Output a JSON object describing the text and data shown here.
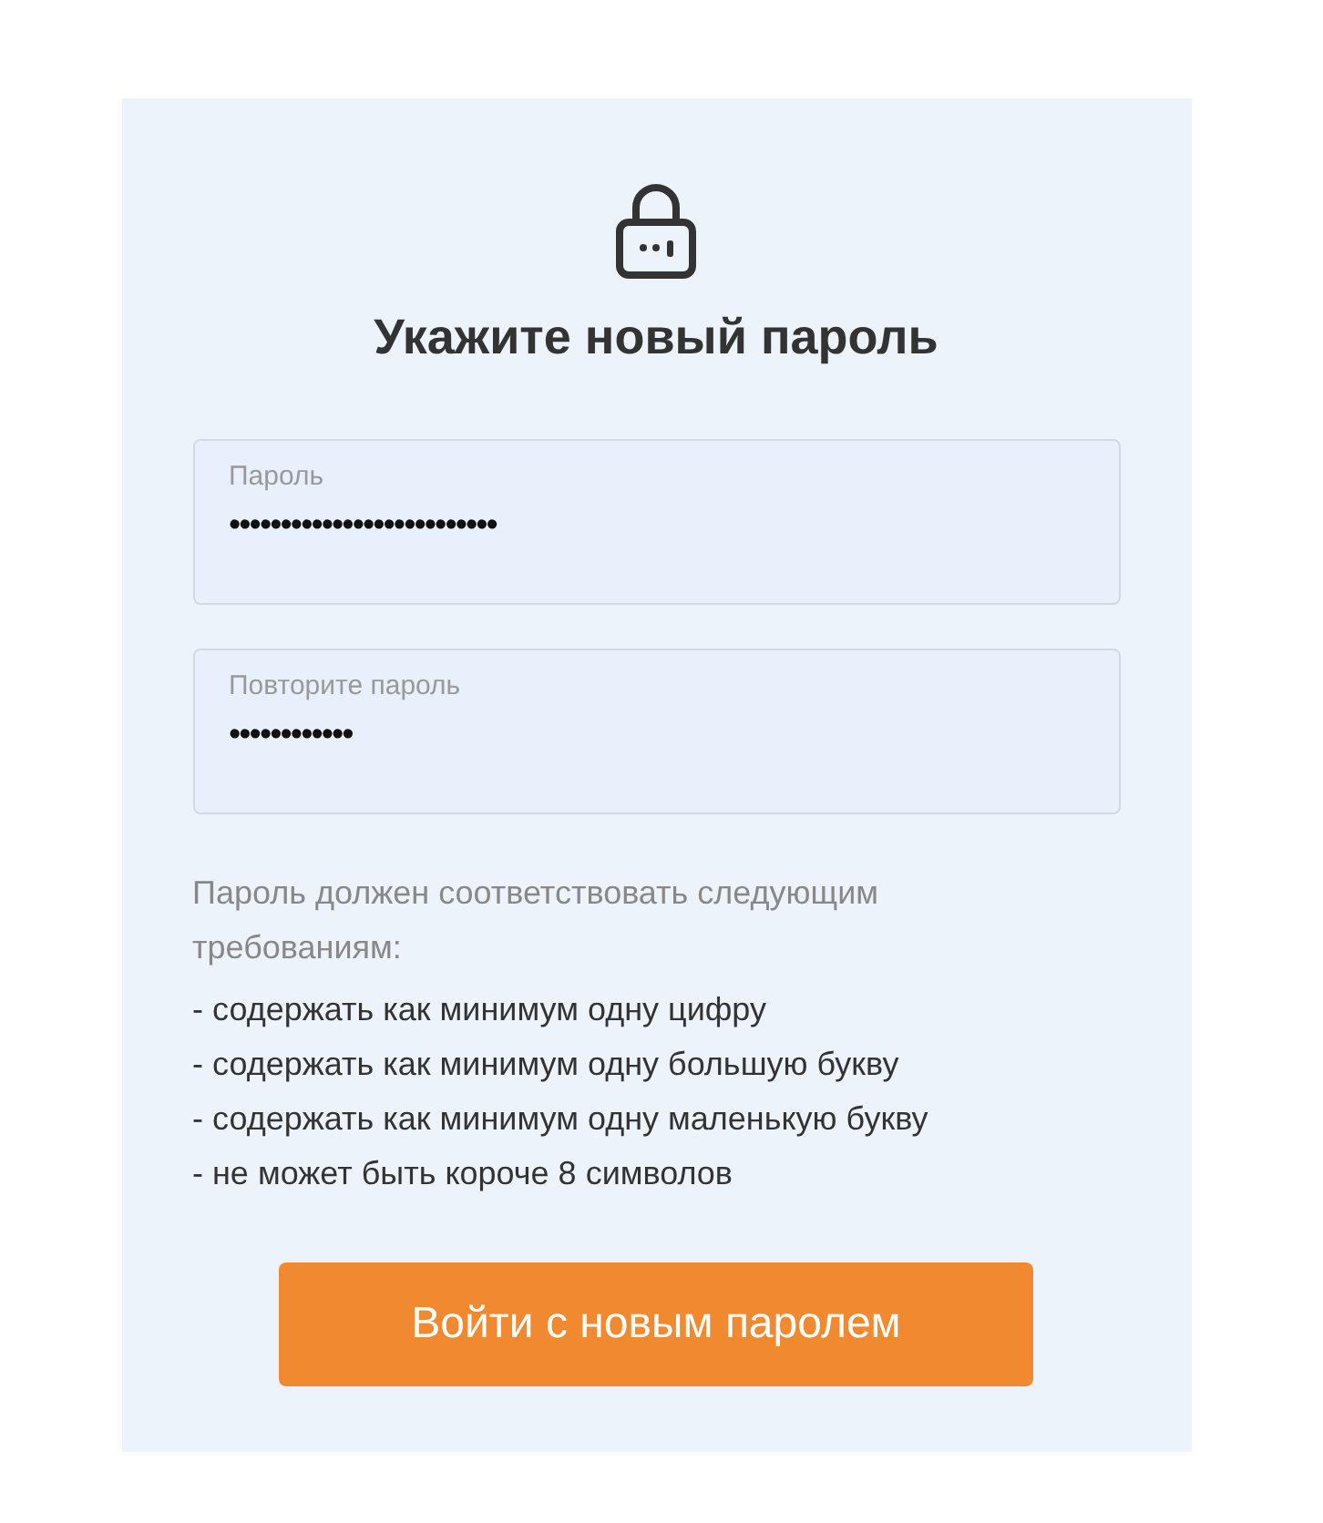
{
  "title": "Укажите новый пароль",
  "fields": [
    {
      "label": "Пароль",
      "value": "••••••••••••••••••••••••••"
    },
    {
      "label": "Повторите пароль",
      "value": "••••••••••••"
    }
  ],
  "hint": "Пароль должен соответствовать следующим требованиям:",
  "requirements": [
    "- содержать как минимум одну цифру",
    "- содержать как минимум одну большую букву",
    "- содержать как минимум одну маленькую букву",
    "- не может быть короче 8 символов"
  ],
  "button": "Войти с новым паролем"
}
